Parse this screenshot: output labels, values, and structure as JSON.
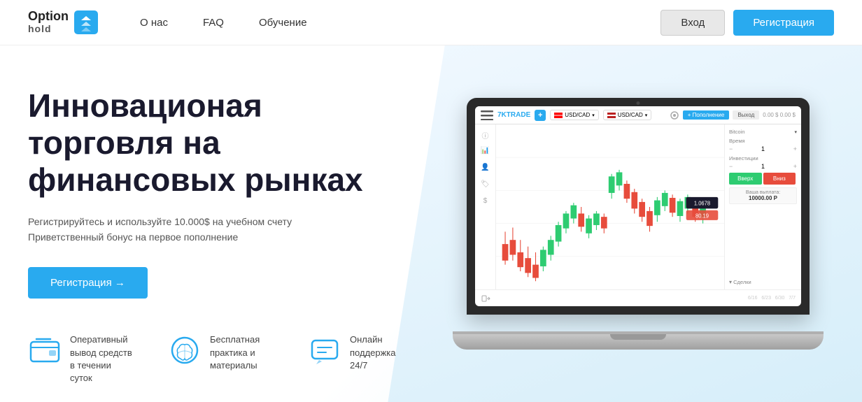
{
  "header": {
    "logo_option": "Option",
    "logo_hold": "hold",
    "nav": {
      "about": "О нас",
      "faq": "FAQ",
      "education": "Обучение"
    },
    "btn_login": "Вход",
    "btn_register": "Регистрация"
  },
  "hero": {
    "title": "Инновационая торговля на финансовых рынках",
    "subtitle_line1": "Регистрируйтесь и используйте 10.000$ на учебном счету",
    "subtitle_line2": "Приветственный бонус на первое пополнение",
    "btn_register": "Регистрация →",
    "features": [
      {
        "icon": "wallet",
        "text": "Оперативный вывод средств в течении суток"
      },
      {
        "icon": "brain",
        "text": "Бесплатная практика и материалы"
      },
      {
        "icon": "chat",
        "text": "Онлайн поддержка 24/7"
      }
    ]
  },
  "trading_ui": {
    "logo": "7KTRADE",
    "currency1": "USD/CAD",
    "currency2": "USD/CAD",
    "btn_fill": "+ Пополнение",
    "btn_exit": "Выход",
    "balance1": "0.00 $",
    "balance2": "0.00 $",
    "asset_label": "Bitcoin",
    "time_label": "Время",
    "time_value": "1",
    "investment_label": "Инвестиции",
    "investment_value": "1",
    "btn_up": "Вверх",
    "btn_down": "Вниз",
    "payout_label": "Ваша выплата:",
    "payout_value": "10000.00 Р",
    "deals_label": "Сделки",
    "price_tag": "1.0678",
    "price_tag2": "80.19"
  }
}
